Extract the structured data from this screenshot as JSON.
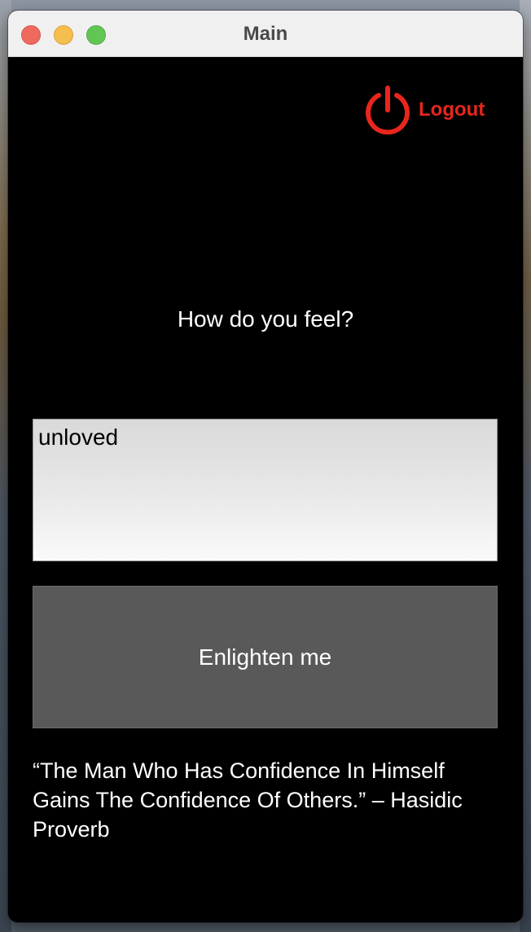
{
  "window": {
    "title": "Main"
  },
  "header": {
    "logout_label": "Logout",
    "logout_icon": "power-icon",
    "accent_color": "#e8261c"
  },
  "main": {
    "prompt": "How do you feel?",
    "feeling_input_value": "unloved",
    "submit_label": "Enlighten me",
    "quote": "“The Man Who Has Confidence In Himself Gains The Confidence Of Others.” – Hasidic Proverb"
  }
}
